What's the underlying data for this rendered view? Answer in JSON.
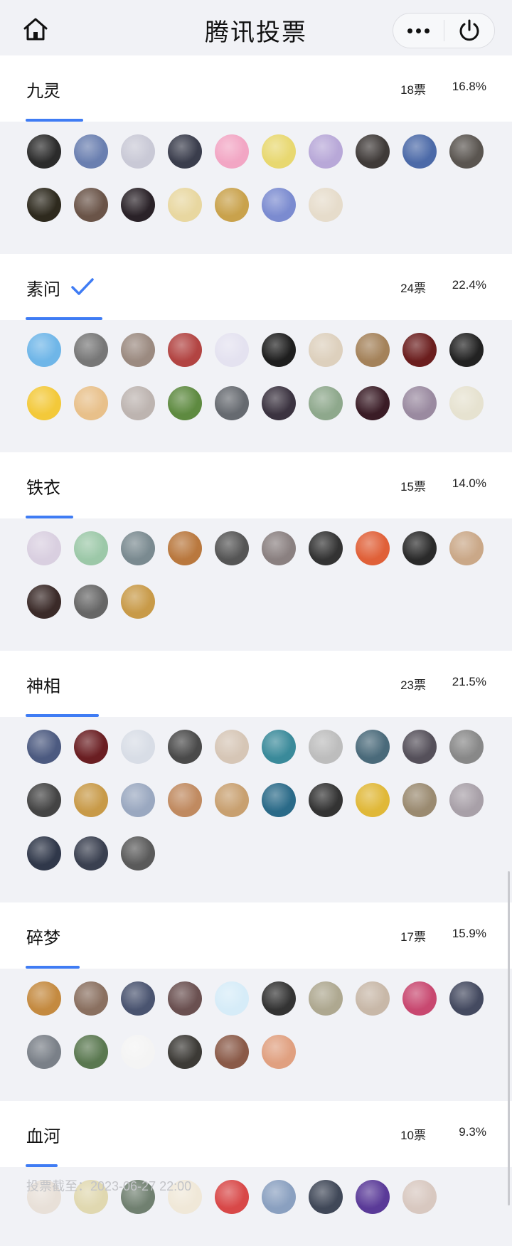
{
  "header": {
    "title": "腾讯投票",
    "home_icon": "home-icon",
    "more_icon": "more-dots-icon",
    "close_icon": "power-icon"
  },
  "accent_color": "#3f7cf4",
  "options": [
    {
      "name": "九灵",
      "votes": "18票",
      "percent": "16.8%",
      "share": 0.168,
      "checked": false,
      "avatars": [
        "#2b2b2b",
        "#6a7fb0",
        "#c9c9d6",
        "#3a3d4c",
        "#f2a6c4",
        "#e8d870",
        "#b8a8d8",
        "#3f3a38",
        "#4c6aa8",
        "#5a5550",
        "#2e2a1e",
        "#6a5448",
        "#2a2228",
        "#e8d7a0",
        "#c9a24c",
        "#7b8bd0",
        "#e6dccb"
      ]
    },
    {
      "name": "素问",
      "votes": "24票",
      "percent": "22.4%",
      "share": 0.224,
      "checked": true,
      "avatars": [
        "#6fb6e8",
        "#777",
        "#9b8a80",
        "#b24442",
        "#e4e2f0",
        "#1e1e1e",
        "#ddd0bd",
        "#a4825a",
        "#6b1e1e",
        "#222",
        "#f3c93a",
        "#e8c08a",
        "#bdb4b0",
        "#5e8a40",
        "#666a70",
        "#3b3340",
        "#8ea88c",
        "#3a1c26",
        "#9a8aa0",
        "#e6e2d0"
      ]
    },
    {
      "name": "铁衣",
      "votes": "15票",
      "percent": "14.0%",
      "share": 0.14,
      "checked": false,
      "avatars": [
        "#d9cfe0",
        "#9cc8a8",
        "#7a8a90",
        "#b9783e",
        "#555",
        "#8a8080",
        "#333",
        "#e06038",
        "#2a2a2a",
        "#caa888",
        "#3a2a28",
        "#666",
        "#c89a48"
      ]
    },
    {
      "name": "神相",
      "votes": "23票",
      "percent": "21.5%",
      "share": 0.215,
      "checked": false,
      "avatars": [
        "#4c5a80",
        "#6a1e22",
        "#d8dde6",
        "#4a4a4a",
        "#d6c6b6",
        "#3a8a9a",
        "#bdbdbd",
        "#4a6a7a",
        "#55505a",
        "#888",
        "#444",
        "#c89a48",
        "#9aa8c0",
        "#c08a60",
        "#c8a070",
        "#2a6a88",
        "#333",
        "#e0b838",
        "#9a8a70",
        "#a8a0a8",
        "#30384a",
        "#3a4050",
        "#5a5a5a"
      ]
    },
    {
      "name": "碎梦",
      "votes": "17票",
      "percent": "15.9%",
      "share": 0.159,
      "checked": false,
      "avatars": [
        "#c48a40",
        "#8a7060",
        "#4a5470",
        "#6a5050",
        "#d6ecf8",
        "#333",
        "#aea890",
        "#c8b8a8",
        "#c84870",
        "#444a60",
        "#7a8088",
        "#5a7850",
        "#f4f4f4",
        "#3c3a36",
        "#8a5a48",
        "#e0a080"
      ]
    },
    {
      "name": "血河",
      "votes": "10票",
      "percent": "9.3%",
      "share": 0.093,
      "checked": false,
      "avatars": [
        "#e8e0d8",
        "#e0d8b0",
        "#708070",
        "#f0e8d8",
        "#d84848",
        "#8aa0c0",
        "#404858",
        "#5a3a98",
        "#d8c8c0"
      ]
    }
  ],
  "footer": {
    "deadline": "投票截至：2023-06-27 22:00"
  }
}
